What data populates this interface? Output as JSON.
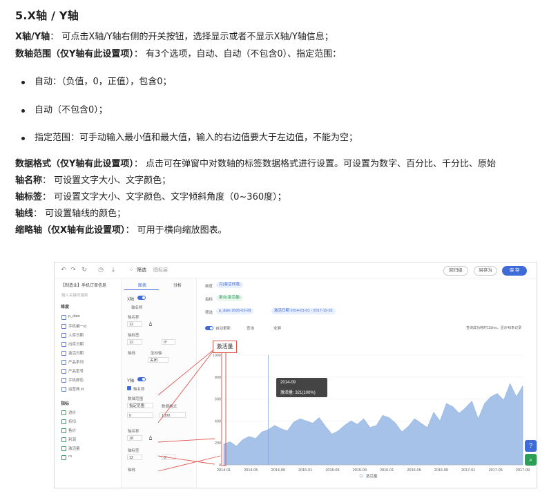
{
  "heading": "5.X轴 / Y轴",
  "para1": {
    "label": "X轴/Y轴",
    "text": "：  可点击X轴/Y轴右侧的开关按钮，选择显示或者不显示X轴/Y轴信息；"
  },
  "para2": {
    "label": "数轴范围（仅Y轴有此设置项）",
    "text": "：  有3个选项，自动、自动（不包含0）、指定范围："
  },
  "bullets": [
    "自动：（负值，0，正值），包含0；",
    "自动（不包含0）；",
    "指定范围：可手动输入最小值和最大值，输入的右边值要大于左边值，不能为空；"
  ],
  "para3": {
    "label": "数据格式（仅Y轴有此设置项）",
    "text": "：  点击可在弹窗中对数轴的标签数据格式进行设置。可设置为数字、百分比、千分比、原始"
  },
  "para4": {
    "label": "轴名称",
    "text": "：  可设置文字大小、文字颜色；"
  },
  "para5": {
    "label": "轴标签",
    "text": "：  可设置文字大小、文字颜色、文字倾斜角度（0~360度）；"
  },
  "para6": {
    "label": "轴线",
    "text": "：  可设置轴线的颜色；"
  },
  "para7": {
    "label": "缩略轴（仅X轴有此设置项）",
    "text": "：  可用于横向缩放图表。"
  },
  "screenshot": {
    "topbar": {
      "icons": [
        "undo-icon",
        "redo-icon",
        "refresh-icon",
        "history-icon",
        "download-icon",
        "filter-icon"
      ],
      "filter_label": "筛选",
      "layer_label": "图标层",
      "btn_back": "回归级",
      "btn_saveas": "另存为",
      "btn_save": "保 存"
    },
    "left": {
      "title": "【制造业】手机订单信息",
      "search_placeholder": "输入关键词搜索",
      "dim_header": "维度",
      "dims": [
        "p_date",
        "手机编一id",
        "入库日期",
        "出库日期",
        "激活日期",
        "产品系列",
        "产品型号",
        "手机颜色",
        "运营商 id"
      ],
      "measure_header": "指标",
      "measures": [
        "进价",
        "折扣",
        "售价",
        "利润",
        "激活量",
        "rn"
      ]
    },
    "mid": {
      "tab_chart": "图表",
      "tab_analysis": "分析",
      "x_axis": "X轴",
      "axis_name_cb": "轴名称",
      "axis_name": "轴名称",
      "font_12": "12",
      "font_color": "A",
      "axis_label": "轴标签",
      "font_size_12b": "12",
      "angle_0": "0°",
      "axis_line": "轴线",
      "ticks": "坐标轴",
      "close": "关闭",
      "y_axis": "Y轴",
      "y_axis_name_cb": "轴名称",
      "range_label": "数轴范围",
      "range_select": "指定范围",
      "data_format": "数据格式",
      "range_min": "0",
      "range_max": "1000",
      "y_name": "轴名称",
      "y_font": "18",
      "y_label": "轴标签",
      "y_font2": "12",
      "y_angle": "0°",
      "y_line": "轴线"
    },
    "right": {
      "row1_label": "维度",
      "row1_pill": "月(激活日期)",
      "row2_label": "指标",
      "row2_pill": "聚合(激活量)",
      "row3_label": "筛选",
      "row3_pill1": "p_date 2020-02-09",
      "row3_pill2": "激活日期 2014-01-01 - 2017-12-31",
      "auto_update": "自动更新",
      "query": "查询",
      "fullscreen": "全屏",
      "status": "查询成功耗时118ms，显示48条记录"
    },
    "chart_data": {
      "type": "area",
      "ylabel": "激活量",
      "yticks": [
        "0",
        "200",
        "400",
        "600",
        "800",
        "1000"
      ],
      "ylim": [
        0,
        1000
      ],
      "xticks": [
        "2014-01",
        "2014-05",
        "2014-09",
        "2015-01",
        "2015-05",
        "2015-09",
        "2016-01",
        "2016-05",
        "2016-09",
        "2017-01",
        "2017-05",
        "2017-09"
      ],
      "values": [
        190,
        210,
        170,
        230,
        260,
        240,
        300,
        321,
        360,
        330,
        310,
        390,
        420,
        400,
        380,
        430,
        350,
        280,
        310,
        360,
        400,
        370,
        420,
        340,
        360,
        450,
        430,
        380,
        300,
        350,
        420,
        380,
        340,
        480,
        400,
        560,
        530,
        470,
        520,
        580,
        420,
        560,
        620,
        650,
        590,
        740,
        620,
        720
      ],
      "legend": "激活量",
      "color": "#a7c2e8"
    },
    "callout": "激活量",
    "tooltip": {
      "title": "2014-09",
      "line": "激活量: 321(100%)"
    }
  },
  "colors": {
    "accent": "#3f6bd8",
    "annotation": "#e0574f",
    "area": "#a7c2e8"
  }
}
